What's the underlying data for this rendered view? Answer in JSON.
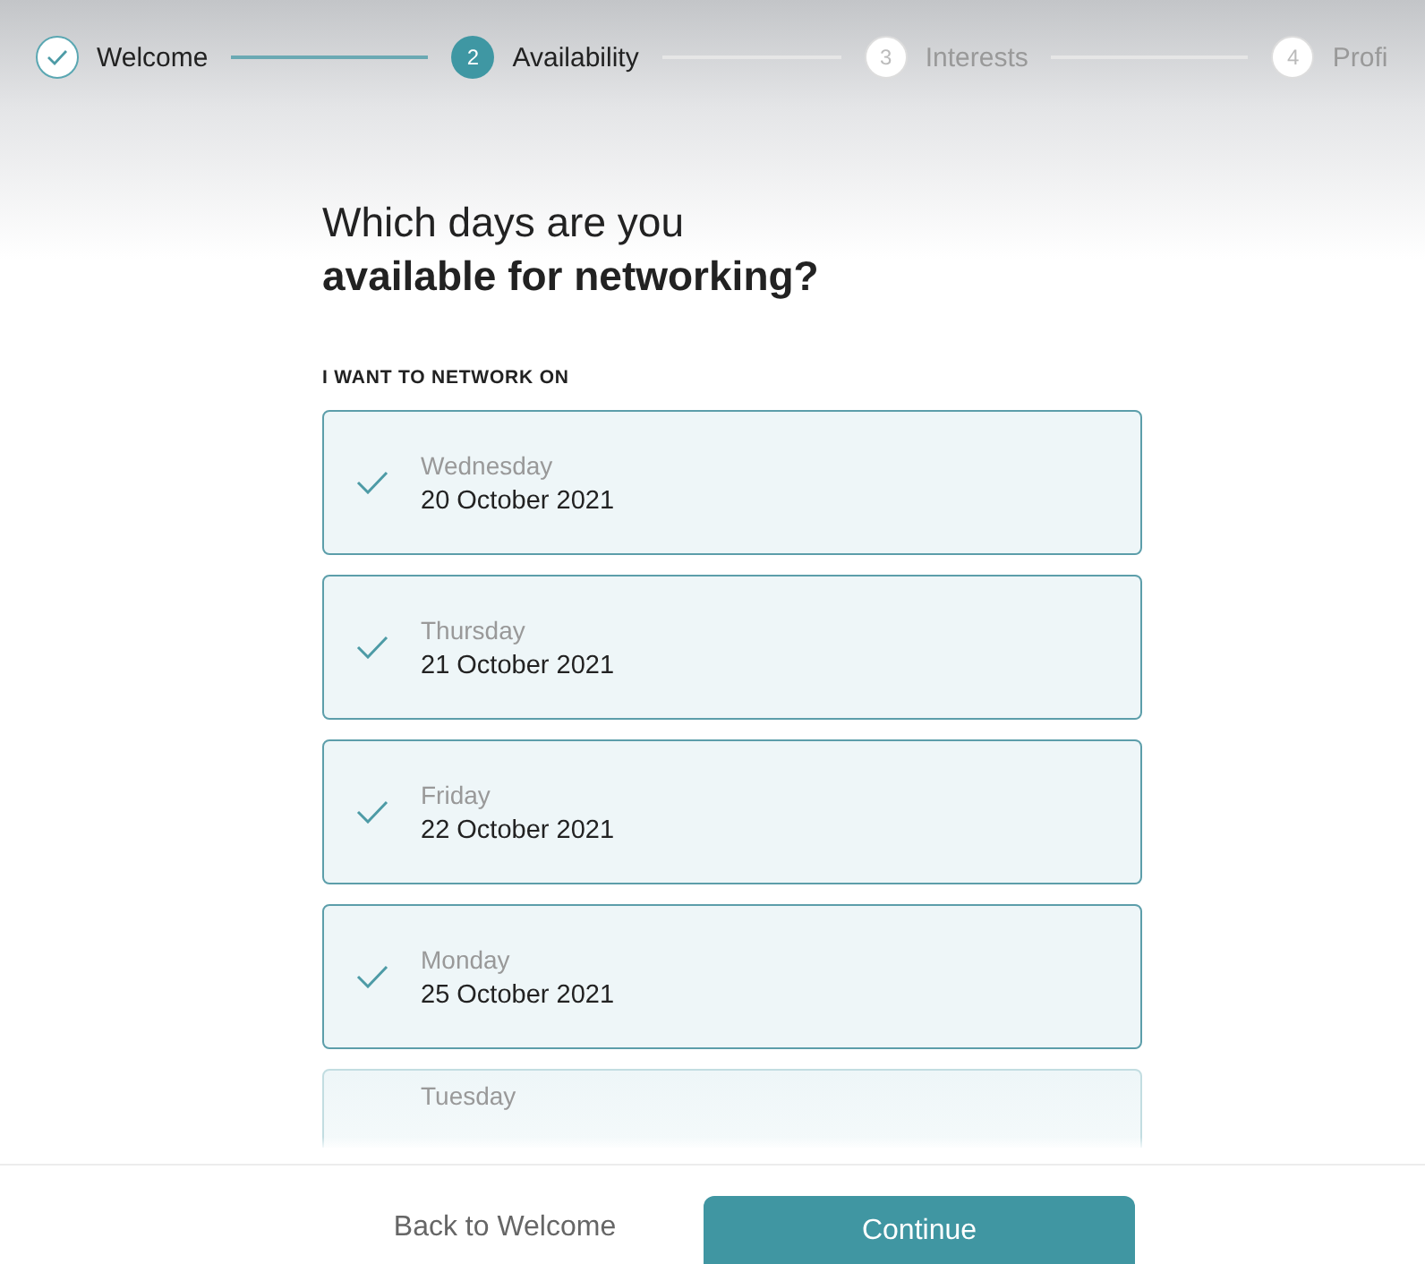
{
  "steps": [
    {
      "label": "Welcome",
      "kind": "done"
    },
    {
      "marker": "2",
      "label": "Availability",
      "kind": "current"
    },
    {
      "marker": "3",
      "label": "Interests",
      "kind": "upcoming"
    },
    {
      "marker": "4",
      "label": "Profi",
      "kind": "upcoming"
    }
  ],
  "heading": {
    "line_1": "Which days are you",
    "line_2": "available for networking?"
  },
  "section_label": "I WANT TO NETWORK ON",
  "days": [
    {
      "weekday": "Wednesday",
      "date": "20 October 2021",
      "checked": true
    },
    {
      "weekday": "Thursday",
      "date": "21 October 2021",
      "checked": true
    },
    {
      "weekday": "Friday",
      "date": "22 October 2021",
      "checked": true
    },
    {
      "weekday": "Monday",
      "date": "25 October 2021",
      "checked": true
    },
    {
      "weekday": "Tuesday",
      "checked": false
    }
  ],
  "footer": {
    "back": "Back to Welcome",
    "continue": "Continue"
  }
}
